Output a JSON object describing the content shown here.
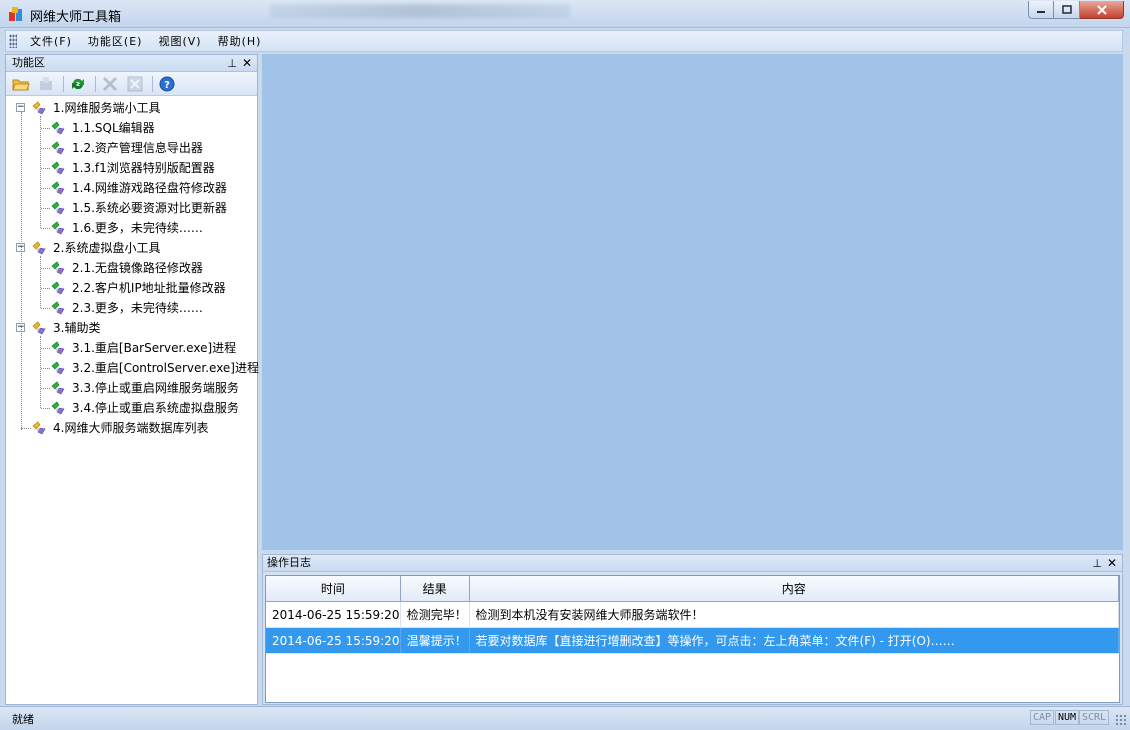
{
  "window": {
    "title": "网维大师工具箱",
    "controls": [
      "minimize",
      "maximize",
      "close"
    ]
  },
  "menu": [
    {
      "label": "文件(F)"
    },
    {
      "label": "功能区(E)"
    },
    {
      "label": "视图(V)"
    },
    {
      "label": "帮助(H)"
    }
  ],
  "left_panel": {
    "title": "功能区",
    "pin_glyph": "⊥",
    "close_glyph": "✕",
    "toolbar": [
      "open-folder-icon",
      "import-icon",
      "refresh-icon",
      "delete-icon",
      "close-box-icon",
      "help-icon"
    ],
    "tree": [
      {
        "label": "1.网维服务端小工具",
        "children": [
          "1.1.SQL编辑器",
          "1.2.资产管理信息导出器",
          "1.3.f1浏览器特别版配置器",
          "1.4.网维游戏路径盘符修改器",
          "1.5.系统必要资源对比更新器",
          "1.6.更多，未完待续……"
        ]
      },
      {
        "label": "2.系统虚拟盘小工具",
        "children": [
          "2.1.无盘镜像路径修改器",
          "2.2.客户机IP地址批量修改器",
          "2.3.更多，未完待续……"
        ]
      },
      {
        "label": "3.辅助类",
        "children": [
          "3.1.重启[BarServer.exe]进程",
          "3.2.重启[ControlServer.exe]进程",
          "3.3.停止或重启网维服务端服务",
          "3.4.停止或重启系统虚拟盘服务"
        ]
      },
      {
        "label": "4.网维大师服务端数据库列表",
        "children": []
      }
    ]
  },
  "log_panel": {
    "title": "操作日志",
    "pin_glyph": "⊥",
    "close_glyph": "✕",
    "columns": [
      "时间",
      "结果",
      "内容"
    ],
    "rows": [
      {
        "time": "2014-06-25 15:59:20",
        "result": "检测完毕！",
        "content": "检测到本机没有安装网维大师服务端软件！",
        "selected": false
      },
      {
        "time": "2014-06-25 15:59:20",
        "result": "温馨提示！",
        "content": "若要对数据库【直接进行增删改查】等操作，可点击：左上角菜单：文件(F) - 打开(O)……",
        "selected": true
      }
    ]
  },
  "statusbar": {
    "text": "就绪",
    "indicators": [
      {
        "label": "CAP",
        "on": false
      },
      {
        "label": "NUM",
        "on": true
      },
      {
        "label": "SCRL",
        "on": false
      }
    ]
  },
  "colors": {
    "main_area": "#a2c3e8",
    "selected_row": "#3399ee"
  }
}
